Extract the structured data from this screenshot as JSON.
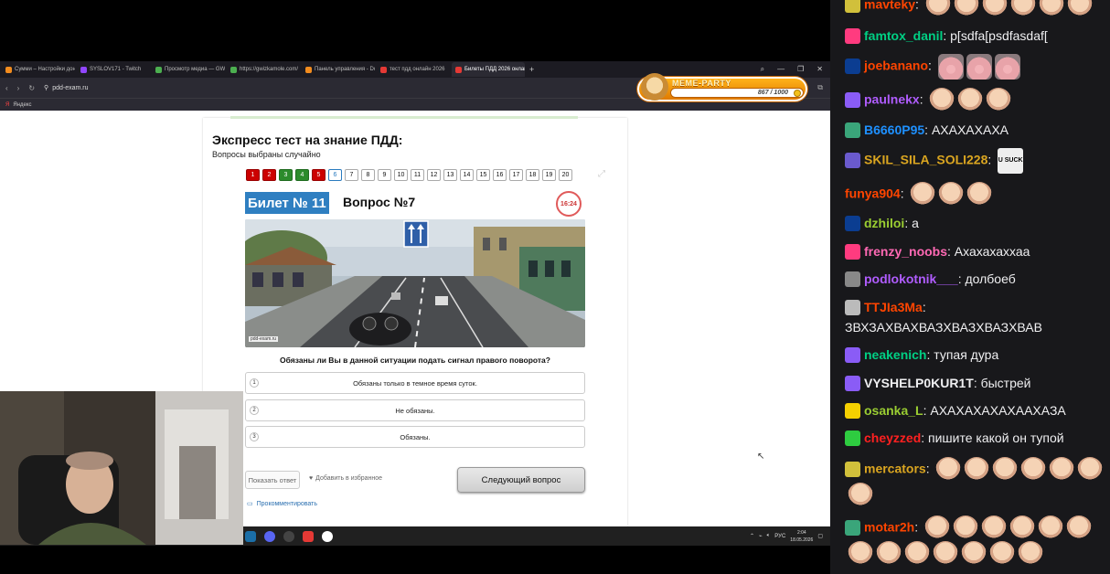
{
  "browser": {
    "tabs": [
      {
        "label": "Сумми – Настройки дон",
        "color": "#f28c1e",
        "active": false
      },
      {
        "label": "SYSLOV171 - Twitch",
        "color": "#9146ff",
        "active": false
      },
      {
        "label": "Просмотр медиа — GWI",
        "color": "#4caf50",
        "active": false
      },
      {
        "label": "https://gwizkamole.com/",
        "color": "#4caf50",
        "active": false
      },
      {
        "label": "Панель управления - Do",
        "color": "#f28c1e",
        "active": false
      },
      {
        "label": "тест пдд онлайн 2026",
        "color": "#e53935",
        "active": false
      },
      {
        "label": "Билеты ПДД 2026 онлай",
        "color": "#e53935",
        "active": true
      }
    ],
    "url": "pdd-exam.ru",
    "bookmark": "Яндекс"
  },
  "meme_party": {
    "title": "MEME-PARTY",
    "progress_text": "867 / 1000",
    "progress": 0.867
  },
  "test": {
    "heading": "Экспресс тест на знание ПДД:",
    "subheading": "Вопросы выбраны случайно",
    "questions": [
      {
        "n": "1",
        "state": "wrong"
      },
      {
        "n": "2",
        "state": "wrong"
      },
      {
        "n": "3",
        "state": "right"
      },
      {
        "n": "4",
        "state": "right"
      },
      {
        "n": "5",
        "state": "wrong"
      },
      {
        "n": "6",
        "state": "current"
      },
      {
        "n": "7",
        "state": "none"
      },
      {
        "n": "8",
        "state": "none"
      },
      {
        "n": "9",
        "state": "none"
      },
      {
        "n": "10",
        "state": "none"
      },
      {
        "n": "11",
        "state": "none"
      },
      {
        "n": "12",
        "state": "none"
      },
      {
        "n": "13",
        "state": "none"
      },
      {
        "n": "14",
        "state": "none"
      },
      {
        "n": "15",
        "state": "none"
      },
      {
        "n": "16",
        "state": "none"
      },
      {
        "n": "17",
        "state": "none"
      },
      {
        "n": "18",
        "state": "none"
      },
      {
        "n": "19",
        "state": "none"
      },
      {
        "n": "20",
        "state": "none"
      }
    ],
    "ticket": "Билет № 11",
    "question_title": "Вопрос №7",
    "timer": "16:24",
    "image_credit": "pdd-exam.ru",
    "question_text": "Обязаны ли Вы в данной ситуации подать сигнал правого поворота?",
    "answers": [
      {
        "n": "1",
        "text": "Обязаны только в темное время суток."
      },
      {
        "n": "2",
        "text": "Не обязаны."
      },
      {
        "n": "3",
        "text": "Обязаны."
      }
    ],
    "show_answer": "Показать ответ",
    "favorite": "Добавить в избранное",
    "next": "Следующий вопрос",
    "comment": "Прокомментировать"
  },
  "taskbar": {
    "lang": "РУС",
    "time": "2:04",
    "date": "18.05.2026"
  },
  "chat": [
    {
      "user": "mavteky",
      "color": "#ff4500",
      "badge": "#d1c03b",
      "text": "",
      "emotes": [
        "bald",
        "bald",
        "bald",
        "bald",
        "bald",
        "bald"
      ]
    },
    {
      "user": "famtox_danil",
      "color": "#00d084",
      "badge": "#ff3b7f",
      "text": "p[sdfa[psdfasdaf[",
      "emotes": []
    },
    {
      "user": "joebanano",
      "color": "#ff4500",
      "badge": "#0b3d91",
      "text": "",
      "emotes": [
        "pig",
        "pig",
        "pig"
      ]
    },
    {
      "user": "paulnekx",
      "color": "#b05cff",
      "badge": "#8a5cf6",
      "text": "",
      "emotes": [
        "bald",
        "bald",
        "bald"
      ]
    },
    {
      "user": "B6660P95",
      "color": "#1e90ff",
      "badge": "#3aa57a",
      "text": "АХАХАХАХА",
      "emotes": []
    },
    {
      "user": "SKIL_SILA_SOLI228",
      "color": "#daa520",
      "badge": "#6a5acd",
      "text": "",
      "emotes": [
        "suck"
      ]
    },
    {
      "user": "funya904",
      "color": "#ff4500",
      "badge": "",
      "text": "",
      "emotes": [
        "bald",
        "bald",
        "bald"
      ]
    },
    {
      "user": "dzhiloi",
      "color": "#9acd32",
      "badge": "#0b3d91",
      "text": "а",
      "emotes": []
    },
    {
      "user": "frenzy_noobs",
      "color": "#ff69b4",
      "badge": "#ff3b7f",
      "text": "Ахахахаххаа",
      "emotes": []
    },
    {
      "user": "podlokotnik___",
      "color": "#b05cff",
      "badge": "#888888",
      "text": "долбоеб",
      "emotes": []
    },
    {
      "user": "TTJIa3Ma",
      "color": "#ff4500",
      "badge": "#bbbbbb",
      "text": "ЗВХЗАХВАХВАЗХВАЗХВАЗХВАВ",
      "emotes": []
    },
    {
      "user": "neakenich",
      "color": "#00d084",
      "badge": "#8a5cf6",
      "text": "тупая дура",
      "emotes": []
    },
    {
      "user": "VYSHELP0KUR1T",
      "color": "#efeff1",
      "badge": "#8a5cf6",
      "text": "быстрей",
      "emotes": []
    },
    {
      "user": "osanka_L",
      "color": "#9acd32",
      "badge": "#f5d000",
      "text": "АХАХАХАХАХААХАЗА",
      "emotes": []
    },
    {
      "user": "cheyzzed",
      "color": "#ff2020",
      "badge": "#2ecc40",
      "text": "пишите какой он тупой",
      "emotes": []
    },
    {
      "user": "mercators",
      "color": "#daa520",
      "badge": "#d1c03b",
      "text": "",
      "emotes": [
        "bald",
        "bald",
        "bald",
        "bald",
        "bald",
        "bald",
        "bald"
      ]
    },
    {
      "user": "motar2h",
      "color": "#ff4500",
      "badge": "#3aa57a",
      "text": "",
      "emotes": [
        "bald",
        "bald",
        "bald",
        "bald",
        "bald",
        "bald",
        "bald",
        "bald",
        "bald",
        "bald",
        "bald",
        "bald",
        "bald"
      ]
    }
  ]
}
